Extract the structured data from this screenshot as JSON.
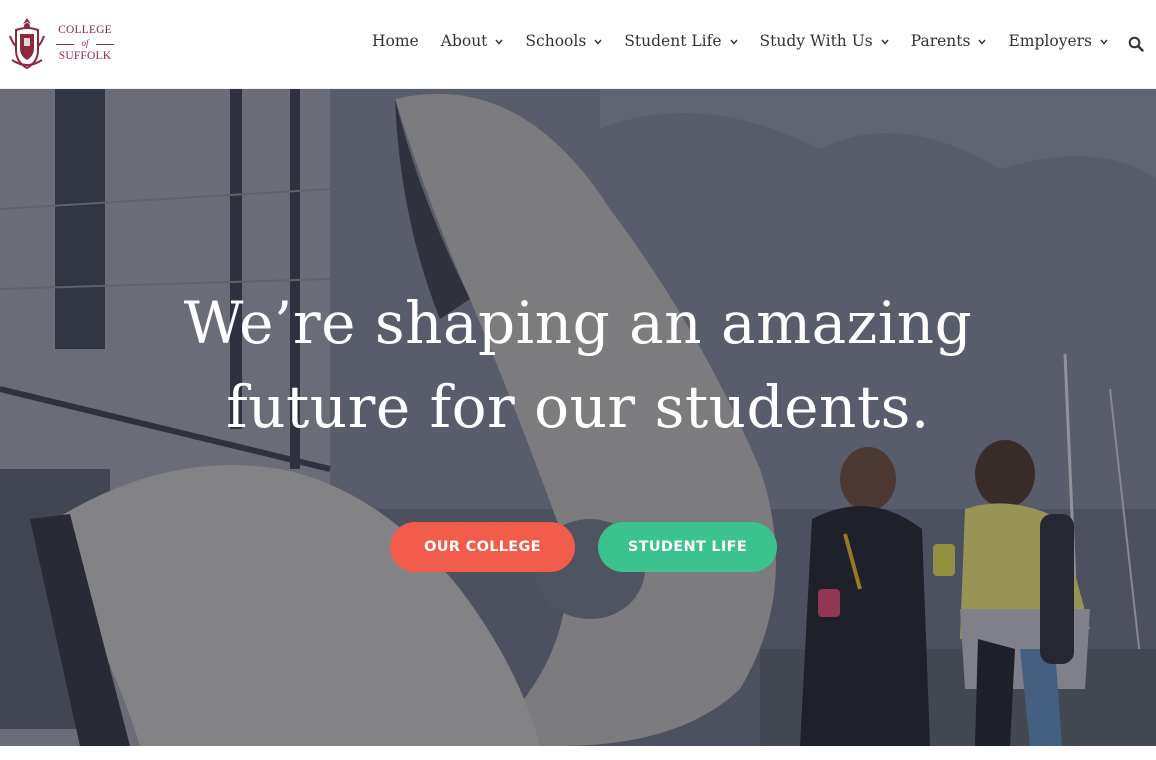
{
  "logo": {
    "line1": "COLLEGE",
    "line2": "of",
    "line3": "SUFFOLK",
    "brand_color": "#8a2a3c"
  },
  "nav": {
    "items": [
      {
        "label": "Home",
        "has_dropdown": false
      },
      {
        "label": "About",
        "has_dropdown": true
      },
      {
        "label": "Schools",
        "has_dropdown": true
      },
      {
        "label": "Student Life",
        "has_dropdown": true
      },
      {
        "label": "Study With Us",
        "has_dropdown": true
      },
      {
        "label": "Parents",
        "has_dropdown": true
      },
      {
        "label": "Employers",
        "has_dropdown": true
      }
    ],
    "search_icon": "search-icon",
    "dropdown_icon": "chevron-down-icon"
  },
  "hero": {
    "headline_line1": "We’re shaping an amazing",
    "headline_line2": "future for our students.",
    "buttons": [
      {
        "label": "OUR COLLEGE",
        "color": "#f25c4a"
      },
      {
        "label": "STUDENT LIFE",
        "color": "#3cc28f"
      }
    ]
  }
}
